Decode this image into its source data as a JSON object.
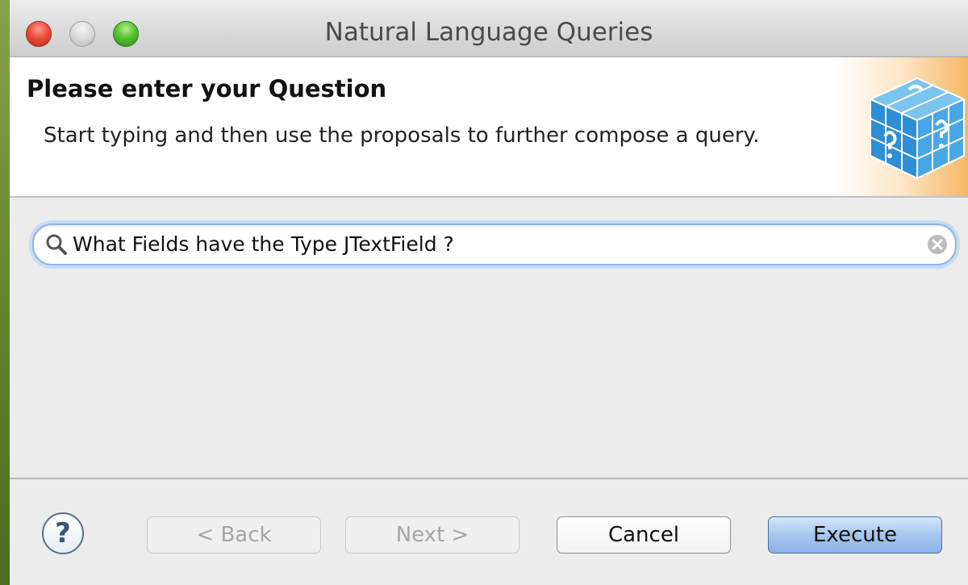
{
  "window": {
    "title": "Natural Language Queries"
  },
  "banner": {
    "heading": "Please enter your Question",
    "subheading": "Start typing and then use the proposals to further compose a query.",
    "icon": "query-cube-icon"
  },
  "search": {
    "value": "What Fields have the Type JTextField ?",
    "placeholder": "",
    "icon": "search-icon",
    "clear_icon": "clear-icon"
  },
  "footer": {
    "help_label": "?",
    "back_label": "< Back",
    "next_label": "Next >",
    "cancel_label": "Cancel",
    "execute_label": "Execute"
  },
  "colors": {
    "focus_ring": "#8fb6e6",
    "default_button": "#a6c6ee",
    "close": "#ee4d3f",
    "minimize": "#d6d6d6",
    "zoom": "#58c22f"
  }
}
